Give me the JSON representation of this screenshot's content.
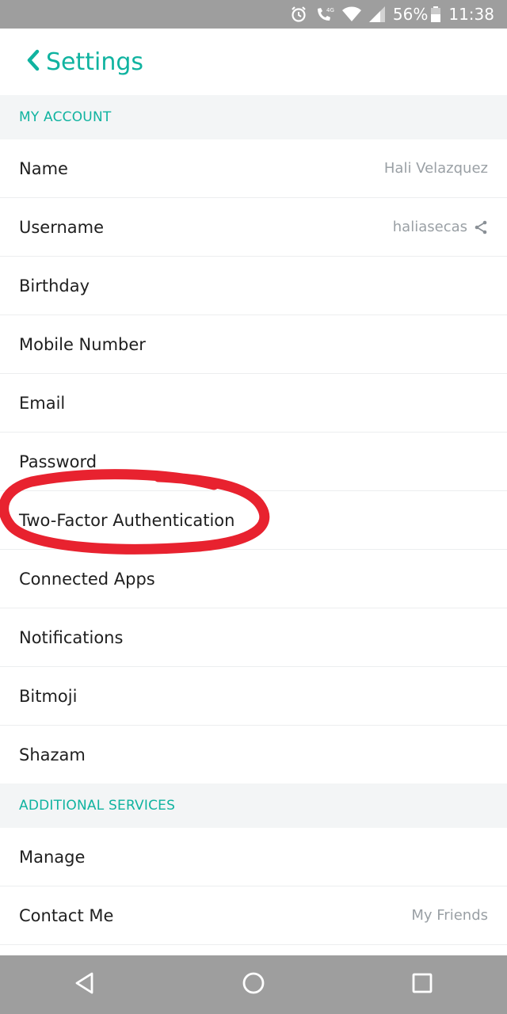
{
  "status_bar": {
    "battery": "56%",
    "time": "11:38",
    "icons": [
      "alarm-icon",
      "phone-4g-icon",
      "wifi-icon",
      "signal-icon",
      "battery-icon"
    ]
  },
  "header": {
    "title": "Settings",
    "back_icon": "chevron-left-icon"
  },
  "sections": {
    "my_account": {
      "title": "MY ACCOUNT",
      "rows": [
        {
          "label": "Name",
          "value": "Hali Velazquez"
        },
        {
          "label": "Username",
          "value": "haliasecas"
        },
        {
          "label": "Birthday",
          "value": ""
        },
        {
          "label": "Mobile Number",
          "value": ""
        },
        {
          "label": "Email",
          "value": ""
        },
        {
          "label": "Password",
          "value": ""
        },
        {
          "label": "Two-Factor Authentication",
          "value": ""
        },
        {
          "label": "Connected Apps",
          "value": ""
        },
        {
          "label": "Notifications",
          "value": ""
        },
        {
          "label": "Bitmoji",
          "value": ""
        },
        {
          "label": "Shazam",
          "value": ""
        }
      ]
    },
    "additional_services": {
      "title": "ADDITIONAL SERVICES",
      "rows": [
        {
          "label": "Manage",
          "value": ""
        },
        {
          "label": "Contact Me",
          "value": "My Friends"
        }
      ]
    }
  },
  "annotation": {
    "type": "hand-drawn-ellipse",
    "color": "#e8222f",
    "target": "Two-Factor Authentication"
  },
  "nav_bar": {
    "icons": [
      "back-triangle-icon",
      "home-circle-icon",
      "recents-square-icon"
    ]
  },
  "colors": {
    "accent": "#10b3a0",
    "status_bar": "#9e9e9e",
    "section_bg": "#f3f5f6",
    "annotation": "#e8222f"
  }
}
